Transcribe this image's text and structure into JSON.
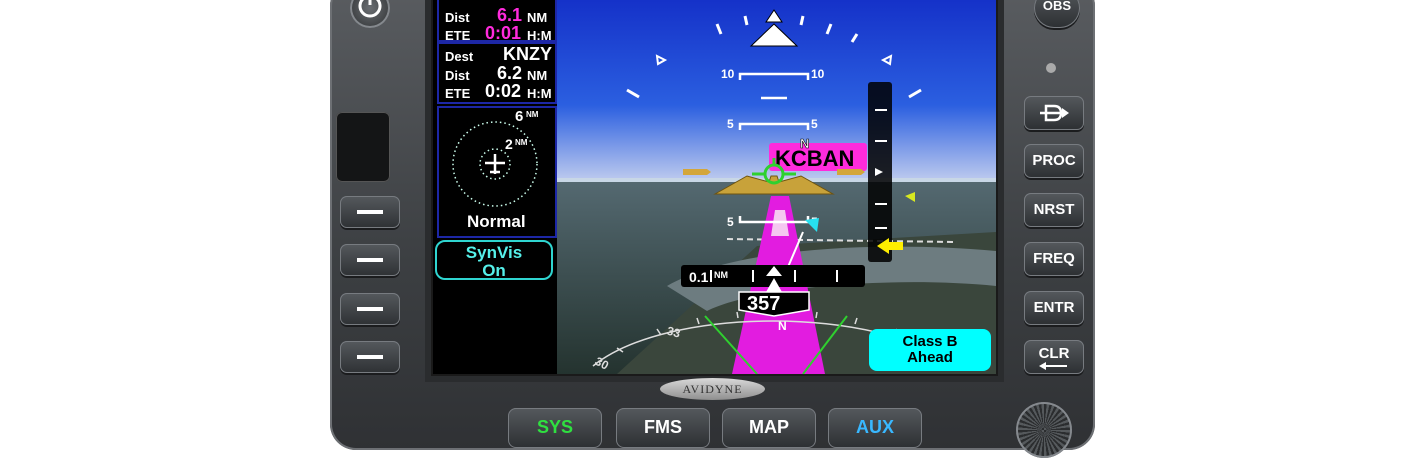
{
  "brand": "AVIDYNE",
  "left_panel": {
    "leg": {
      "dist_label": "Dist",
      "dist_value": "6.1",
      "dist_unit": "NM",
      "ete_label": "ETE",
      "ete_value": "0:01",
      "ete_unit": "H:M"
    },
    "dest": {
      "dest_label": "Dest",
      "dest_value": "KNZY",
      "dist_label": "Dist",
      "dist_value": "6.2",
      "dist_unit": "NM",
      "ete_label": "ETE",
      "ete_value": "0:02",
      "ete_unit": "H:M"
    },
    "traffic": {
      "outer_range": "6",
      "outer_unit": "NM",
      "inner_range": "2",
      "inner_unit": "NM",
      "mode": "Normal"
    },
    "synvis": {
      "line1": "SynVis",
      "line2": "On"
    }
  },
  "pfd": {
    "pitch_labels": [
      "10",
      "10",
      "5",
      "5",
      "5",
      "5"
    ],
    "waypoint": "KCBAN",
    "north_marker": "N",
    "distance": "0.1",
    "distance_unit": "NM",
    "heading": "357",
    "compass_labels": [
      "33",
      "30",
      "N"
    ],
    "alert": {
      "line1": "Class B",
      "line2": "Ahead"
    }
  },
  "right_buttons": [
    "OBS",
    "PROC",
    "NRST",
    "FREQ",
    "ENTR",
    "CLR"
  ],
  "bottom_buttons": [
    "SYS",
    "FMS",
    "MAP",
    "AUX"
  ],
  "colors": {
    "magenta": "#ff2bdc",
    "cyan": "#00ffff",
    "sky": "#1638c8",
    "ground": "#2f3b3e"
  }
}
